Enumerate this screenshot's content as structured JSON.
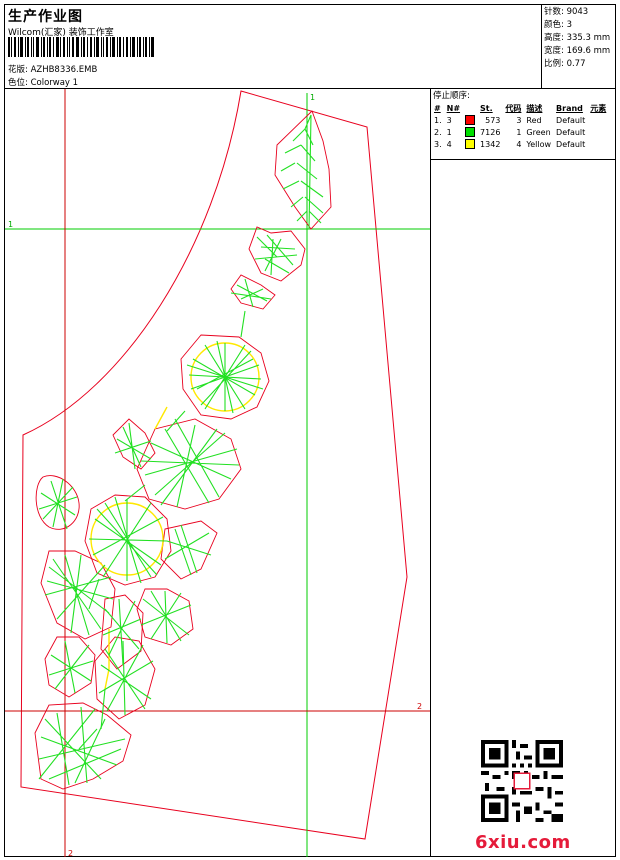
{
  "header": {
    "title": "生产作业图",
    "company": "Wilcom(汇家) 装饰工作室",
    "design_file": "花版: AZHB8336.EMB",
    "colorway": "色位: Colorway 1"
  },
  "stats": {
    "stitches": "针数: 9043",
    "colors": "颜色: 3",
    "height": "高度: 335.3 mm",
    "width": "宽度: 169.6 mm",
    "scale": "比例: 0.77"
  },
  "stop_sequence": {
    "title": "停止顺序:",
    "columns": [
      "#",
      "N#",
      "St.",
      "代码",
      "描述",
      "Brand",
      "元素"
    ],
    "rows": [
      {
        "idx": "1.",
        "n": "3",
        "color": "#ff0000",
        "st": "573",
        "code": "3",
        "desc": "Red",
        "brand": "Default"
      },
      {
        "idx": "2.",
        "n": "1",
        "color": "#00e000",
        "st": "7126",
        "code": "1",
        "desc": "Green",
        "brand": "Default"
      },
      {
        "idx": "3.",
        "n": "4",
        "color": "#ffff00",
        "st": "1342",
        "code": "4",
        "desc": "Yellow",
        "brand": "Default"
      }
    ]
  },
  "guides": {
    "label_1": "1",
    "label_2": "2"
  },
  "watermark": "6xiu.com",
  "colors": {
    "outline": "#e8001e",
    "guide_green": "#00cc00",
    "guide_red": "#cc0000",
    "stitch_green": "#22e022",
    "stitch_yellow": "#ffe800"
  }
}
